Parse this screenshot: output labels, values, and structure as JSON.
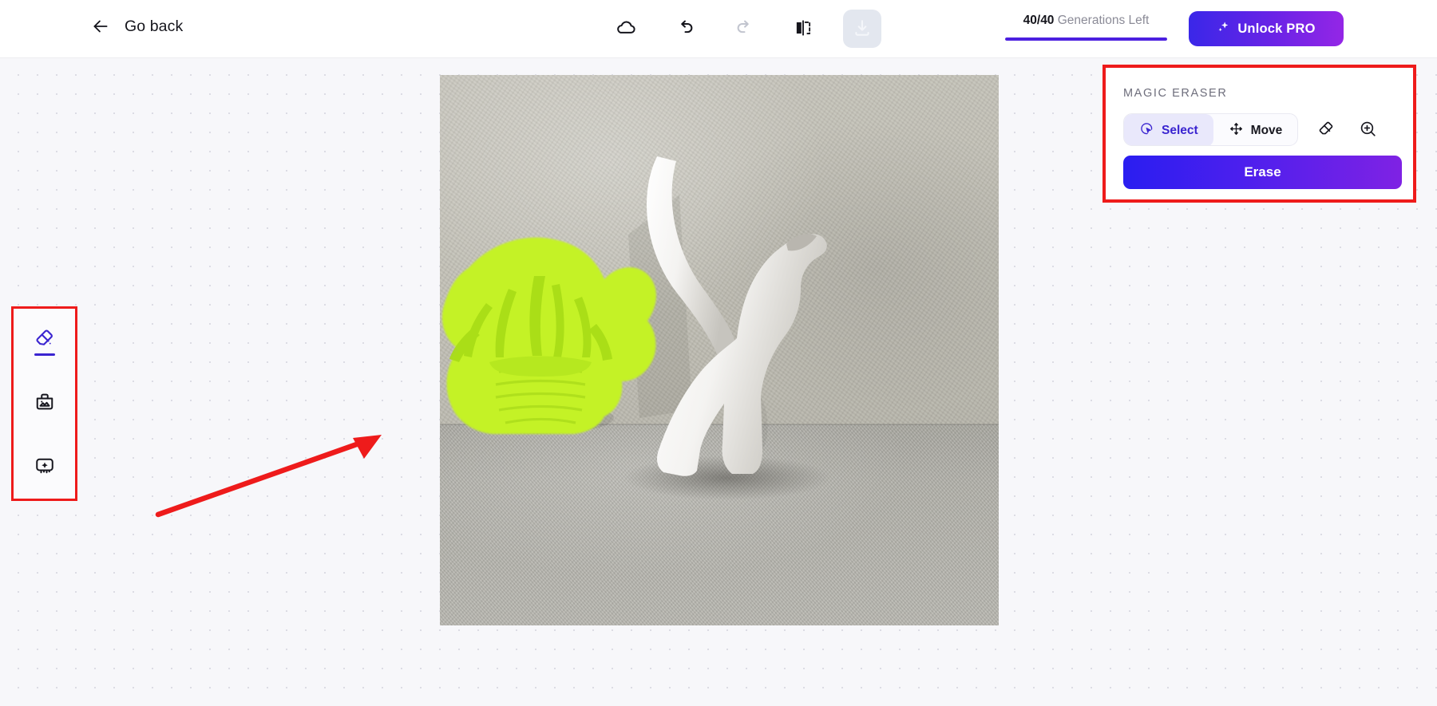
{
  "header": {
    "back_label": "Go back",
    "back_icon": "arrow-left-icon",
    "tools": [
      {
        "name": "cloud-icon",
        "label": "Cloud",
        "state": "enabled"
      },
      {
        "name": "undo-icon",
        "label": "Undo",
        "state": "enabled"
      },
      {
        "name": "redo-icon",
        "label": "Redo",
        "state": "disabled"
      },
      {
        "name": "compare-split-icon",
        "label": "Compare",
        "state": "enabled"
      },
      {
        "name": "download-icon",
        "label": "Download",
        "state": "enabled"
      }
    ],
    "generations": {
      "count": "40/40",
      "label": "Generations Left",
      "progress_percent": 100,
      "bar_color": "#4b1fe0"
    },
    "unlock_pro": {
      "label": "Unlock PRO",
      "icon": "sparkles-icon",
      "gradient_from": "#3a27e8",
      "gradient_to": "#9426e6"
    }
  },
  "left_toolbar": {
    "highlight_color": "#ee1b1b",
    "items": [
      {
        "name": "magic-eraser-tool",
        "icon": "eraser-icon",
        "active": true
      },
      {
        "name": "remove-bg-tool",
        "icon": "image-bag-icon",
        "active": false
      },
      {
        "name": "ai-enhance-tool",
        "icon": "sparkle-frame-icon",
        "active": false
      }
    ]
  },
  "right_panel": {
    "title": "MAGIC ERASER",
    "highlight_color": "#ee1b1b",
    "modes": [
      {
        "label": "Select",
        "icon": "lasso-cursor-icon",
        "active": true
      },
      {
        "label": "Move",
        "icon": "move-arrows-icon",
        "active": false
      }
    ],
    "icon_buttons": [
      {
        "name": "eraser-icon",
        "label": "Eraser"
      },
      {
        "name": "zoom-in-icon",
        "label": "Zoom In"
      }
    ],
    "action": {
      "label": "Erase",
      "gradient_from": "#2a1ef0",
      "gradient_to": "#7f22e4"
    }
  },
  "canvas": {
    "background": "#f7f7fa",
    "dot_color": "#dcdce4",
    "selection_mask_color": "#c4f227",
    "subject": "white cat figurine and potted plant on gray carpet"
  },
  "annotations": {
    "arrow_color": "#ee1b1b",
    "arrow_points_to": "selection-mask"
  }
}
